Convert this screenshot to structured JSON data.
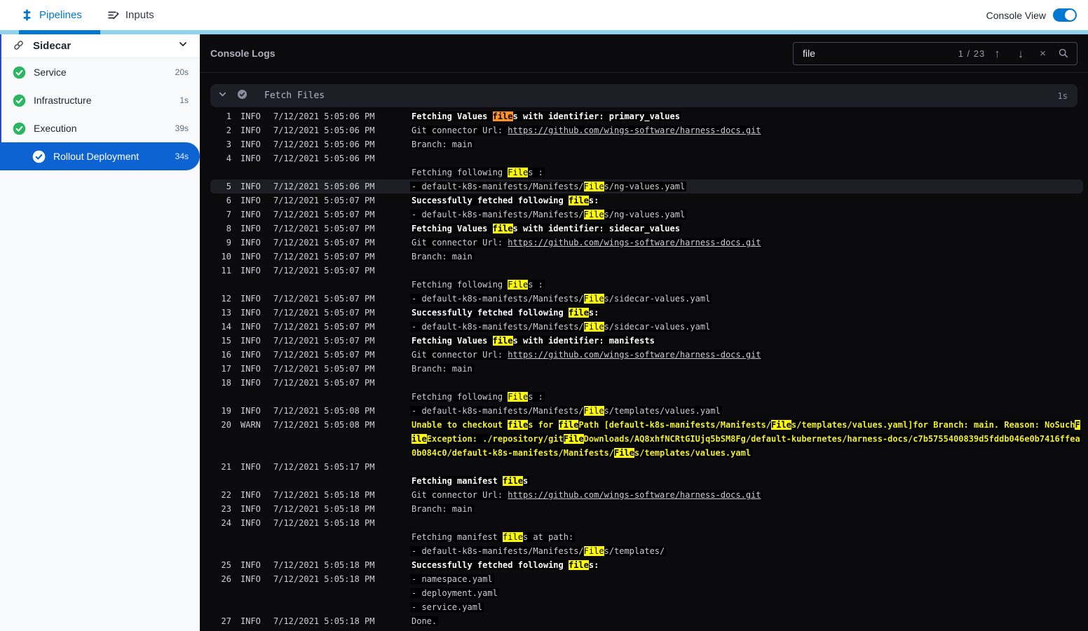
{
  "topbar": {
    "tabs": [
      {
        "label": "Pipelines",
        "active": true
      },
      {
        "label": "Inputs",
        "active": false
      }
    ],
    "console_view_label": "Console View",
    "console_view_on": true
  },
  "sidebar": {
    "title": "Sidecar",
    "items": [
      {
        "label": "Service",
        "duration": "20s",
        "status": "success"
      },
      {
        "label": "Infrastructure",
        "duration": "1s",
        "status": "success"
      },
      {
        "label": "Execution",
        "duration": "39s",
        "status": "success"
      },
      {
        "label": "Rollout Deployment",
        "duration": "34s",
        "status": "current"
      }
    ]
  },
  "console": {
    "title": "Console Logs",
    "search": {
      "value": "file",
      "counter": "1 / 23"
    },
    "section": {
      "title": "Fetch Files",
      "duration": "1s"
    },
    "colors": {
      "accent": "#0278d5",
      "tab_strip": "#8ed2f1",
      "selected_stage": "#0d63d1",
      "success_green": "#2bb661",
      "match_highlight": "#fdfd00",
      "current_match_highlight": "#ff9222",
      "warn_text": "#f1ee26",
      "row_highlight": "#1d1d25"
    },
    "rows": [
      {
        "n": "1",
        "l": "INFO",
        "t": "7/12/2021 5:05:06 PM",
        "b": 1,
        "s": [
          {
            "x": "Fetching Values "
          },
          {
            "x": "file",
            "h": "c"
          },
          {
            "x": "s with identifier: primary_values"
          }
        ]
      },
      {
        "n": "2",
        "l": "INFO",
        "t": "7/12/2021 5:05:06 PM",
        "s": [
          {
            "x": "Git connector Url: "
          },
          {
            "x": "https://github.com/wings-software/harness-docs.git",
            "u": 1
          }
        ]
      },
      {
        "n": "3",
        "l": "INFO",
        "t": "7/12/2021 5:05:06 PM",
        "s": [
          {
            "x": "Branch: main"
          }
        ]
      },
      {
        "n": "4",
        "l": "INFO",
        "t": "7/12/2021 5:05:06 PM",
        "s": []
      },
      {
        "s": [
          {
            "x": "Fetching following "
          },
          {
            "x": "File",
            "h": "m"
          },
          {
            "x": "s :"
          }
        ]
      },
      {
        "n": "5",
        "l": "INFO",
        "t": "7/12/2021 5:05:06 PM",
        "sel": 1,
        "s": [
          {
            "x": "- default-k8s-manifests/Manifests/"
          },
          {
            "x": "File",
            "h": "m"
          },
          {
            "x": "s/ng-values.yaml"
          }
        ]
      },
      {
        "n": "6",
        "l": "INFO",
        "t": "7/12/2021 5:05:07 PM",
        "b": 1,
        "s": [
          {
            "x": "Successfully fetched following "
          },
          {
            "x": "file",
            "h": "m"
          },
          {
            "x": "s:"
          }
        ]
      },
      {
        "n": "7",
        "l": "INFO",
        "t": "7/12/2021 5:05:07 PM",
        "s": [
          {
            "x": "- default-k8s-manifests/Manifests/"
          },
          {
            "x": "File",
            "h": "m"
          },
          {
            "x": "s/ng-values.yaml"
          }
        ]
      },
      {
        "n": "8",
        "l": "INFO",
        "t": "7/12/2021 5:05:07 PM",
        "b": 1,
        "s": [
          {
            "x": "Fetching Values "
          },
          {
            "x": "file",
            "h": "m"
          },
          {
            "x": "s with identifier: sidecar_values"
          }
        ]
      },
      {
        "n": "9",
        "l": "INFO",
        "t": "7/12/2021 5:05:07 PM",
        "s": [
          {
            "x": "Git connector Url: "
          },
          {
            "x": "https://github.com/wings-software/harness-docs.git",
            "u": 1
          }
        ]
      },
      {
        "n": "10",
        "l": "INFO",
        "t": "7/12/2021 5:05:07 PM",
        "s": [
          {
            "x": "Branch: main"
          }
        ]
      },
      {
        "n": "11",
        "l": "INFO",
        "t": "7/12/2021 5:05:07 PM",
        "s": []
      },
      {
        "s": [
          {
            "x": "Fetching following "
          },
          {
            "x": "File",
            "h": "m"
          },
          {
            "x": "s :"
          }
        ]
      },
      {
        "n": "12",
        "l": "INFO",
        "t": "7/12/2021 5:05:07 PM",
        "s": [
          {
            "x": "- default-k8s-manifests/Manifests/"
          },
          {
            "x": "File",
            "h": "m"
          },
          {
            "x": "s/sidecar-values.yaml"
          }
        ]
      },
      {
        "n": "13",
        "l": "INFO",
        "t": "7/12/2021 5:05:07 PM",
        "b": 1,
        "s": [
          {
            "x": "Successfully fetched following "
          },
          {
            "x": "file",
            "h": "m"
          },
          {
            "x": "s:"
          }
        ]
      },
      {
        "n": "14",
        "l": "INFO",
        "t": "7/12/2021 5:05:07 PM",
        "s": [
          {
            "x": "- default-k8s-manifests/Manifests/"
          },
          {
            "x": "File",
            "h": "m"
          },
          {
            "x": "s/sidecar-values.yaml"
          }
        ]
      },
      {
        "n": "15",
        "l": "INFO",
        "t": "7/12/2021 5:05:07 PM",
        "b": 1,
        "s": [
          {
            "x": "Fetching Values "
          },
          {
            "x": "file",
            "h": "m"
          },
          {
            "x": "s with identifier: manifests"
          }
        ]
      },
      {
        "n": "16",
        "l": "INFO",
        "t": "7/12/2021 5:05:07 PM",
        "s": [
          {
            "x": "Git connector Url: "
          },
          {
            "x": "https://github.com/wings-software/harness-docs.git",
            "u": 1
          }
        ]
      },
      {
        "n": "17",
        "l": "INFO",
        "t": "7/12/2021 5:05:07 PM",
        "s": [
          {
            "x": "Branch: main"
          }
        ]
      },
      {
        "n": "18",
        "l": "INFO",
        "t": "7/12/2021 5:05:07 PM",
        "s": []
      },
      {
        "s": [
          {
            "x": "Fetching following "
          },
          {
            "x": "File",
            "h": "m"
          },
          {
            "x": "s :"
          }
        ]
      },
      {
        "n": "19",
        "l": "INFO",
        "t": "7/12/2021 5:05:08 PM",
        "s": [
          {
            "x": "- default-k8s-manifests/Manifests/"
          },
          {
            "x": "File",
            "h": "m"
          },
          {
            "x": "s/templates/values.yaml"
          }
        ]
      },
      {
        "n": "20",
        "l": "WARN",
        "t": "7/12/2021 5:05:08 PM",
        "w": 1,
        "s": [
          {
            "x": "Unable to checkout "
          },
          {
            "x": "file",
            "h": "m"
          },
          {
            "x": "s for "
          },
          {
            "x": "file",
            "h": "m"
          },
          {
            "x": "Path [default-k8s-manifests/Manifests/"
          },
          {
            "x": "File",
            "h": "m"
          },
          {
            "x": "s/templates/values.yaml]for Branch: main. Reason: NoSuch"
          },
          {
            "x": "F",
            "h": "m"
          }
        ]
      },
      {
        "w": 1,
        "s": [
          {
            "x": "ile",
            "h": "m"
          },
          {
            "x": "Exception: ./repository/git"
          },
          {
            "x": "File",
            "h": "m"
          },
          {
            "x": "Downloads/AQ8xhfNCRtGIUjq5bSM8Fg/default-kubernetes/harness-docs/c7b5755400839d5fddb046e0b7416ffea"
          }
        ]
      },
      {
        "w": 1,
        "s": [
          {
            "x": "0b084c0/default-k8s-manifests/Manifests/"
          },
          {
            "x": "File",
            "h": "m"
          },
          {
            "x": "s/templates/values.yaml"
          }
        ]
      },
      {
        "n": "21",
        "l": "INFO",
        "t": "7/12/2021 5:05:17 PM",
        "s": []
      },
      {
        "b": 1,
        "s": [
          {
            "x": "Fetching manifest "
          },
          {
            "x": "file",
            "h": "m"
          },
          {
            "x": "s"
          }
        ]
      },
      {
        "n": "22",
        "l": "INFO",
        "t": "7/12/2021 5:05:18 PM",
        "s": [
          {
            "x": "Git connector Url: "
          },
          {
            "x": "https://github.com/wings-software/harness-docs.git",
            "u": 1
          }
        ]
      },
      {
        "n": "23",
        "l": "INFO",
        "t": "7/12/2021 5:05:18 PM",
        "s": [
          {
            "x": "Branch: main"
          }
        ]
      },
      {
        "n": "24",
        "l": "INFO",
        "t": "7/12/2021 5:05:18 PM",
        "s": []
      },
      {
        "s": [
          {
            "x": "Fetching manifest "
          },
          {
            "x": "file",
            "h": "m"
          },
          {
            "x": "s at path:"
          }
        ]
      },
      {
        "s": [
          {
            "x": "- default-k8s-manifests/Manifests/"
          },
          {
            "x": "File",
            "h": "m"
          },
          {
            "x": "s/templates/"
          }
        ]
      },
      {
        "n": "25",
        "l": "INFO",
        "t": "7/12/2021 5:05:18 PM",
        "b": 1,
        "s": [
          {
            "x": "Successfully fetched following "
          },
          {
            "x": "file",
            "h": "m"
          },
          {
            "x": "s:"
          }
        ]
      },
      {
        "n": "26",
        "l": "INFO",
        "t": "7/12/2021 5:05:18 PM",
        "s": [
          {
            "x": "- namespace.yaml"
          }
        ]
      },
      {
        "s": [
          {
            "x": "- deployment.yaml"
          }
        ]
      },
      {
        "s": [
          {
            "x": "- service.yaml"
          }
        ]
      },
      {
        "n": "27",
        "l": "INFO",
        "t": "7/12/2021 5:05:18 PM",
        "s": [
          {
            "x": "Done."
          }
        ]
      }
    ]
  }
}
